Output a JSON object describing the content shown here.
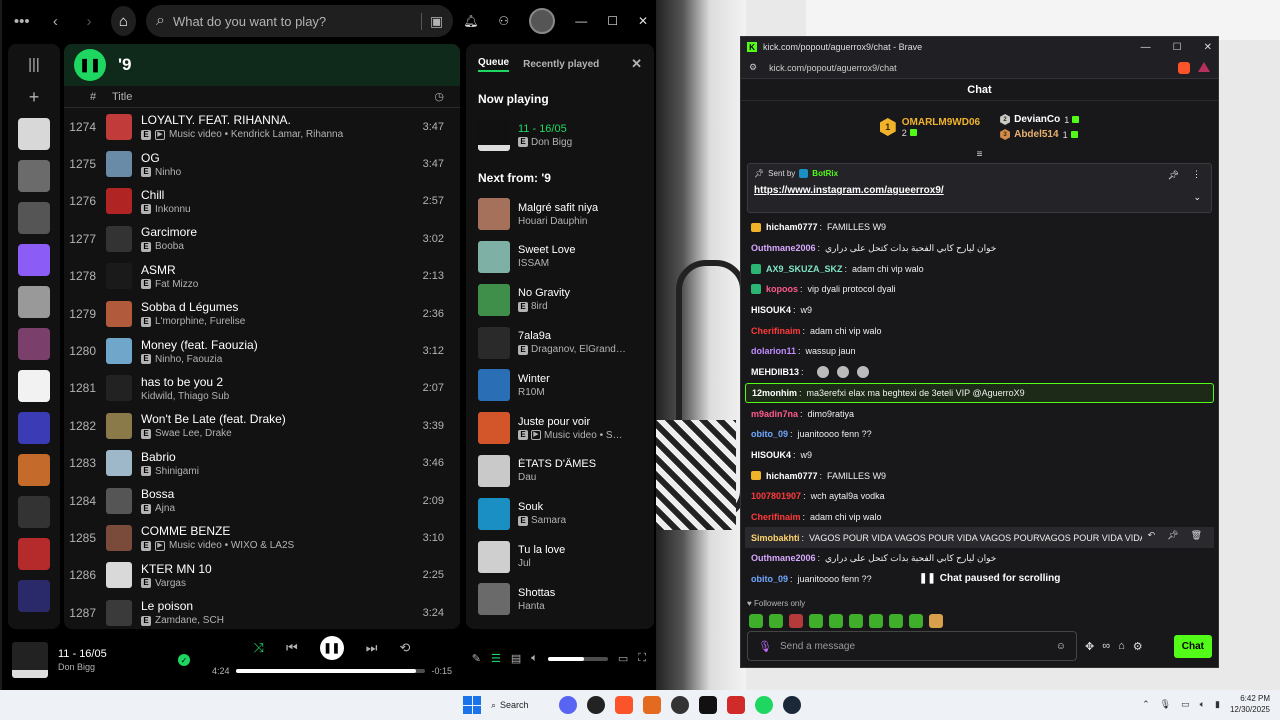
{
  "spotify": {
    "search_placeholder": "What do you want to play?",
    "playlist_title": "'9",
    "columns": {
      "number": "#",
      "title": "Title"
    },
    "tracks": [
      {
        "num": "1274",
        "title": "LOYALTY. FEAT. RIHANNA.",
        "explicit": true,
        "video": true,
        "artists": "Music video • Kendrick Lamar, Rihanna",
        "duration": "3:47",
        "color": "#c23b3b"
      },
      {
        "num": "1275",
        "title": "OG",
        "explicit": true,
        "video": false,
        "artists": "Ninho",
        "duration": "3:47",
        "color": "#6a8ba8"
      },
      {
        "num": "1276",
        "title": "Chill",
        "explicit": true,
        "video": false,
        "artists": "Inkonnu",
        "duration": "2:57",
        "color": "#b02424"
      },
      {
        "num": "1277",
        "title": "Garcimore",
        "explicit": true,
        "video": false,
        "artists": "Booba",
        "duration": "3:02",
        "color": "#333333"
      },
      {
        "num": "1278",
        "title": "ASMR",
        "explicit": true,
        "video": false,
        "artists": "Fat Mizzo",
        "duration": "2:13",
        "color": "#1a1a1a"
      },
      {
        "num": "1279",
        "title": "Sobba d Légumes",
        "explicit": true,
        "video": false,
        "artists": "L'morphine, Furelise",
        "duration": "2:36",
        "color": "#b25a3c"
      },
      {
        "num": "1280",
        "title": "Money (feat. Faouzia)",
        "explicit": true,
        "video": false,
        "artists": "Ninho, Faouzia",
        "duration": "3:12",
        "color": "#6fa6c9"
      },
      {
        "num": "1281",
        "title": "has to be you 2",
        "explicit": false,
        "video": false,
        "artists": "Kidwild, Thiago Sub",
        "duration": "2:07",
        "color": "#222222"
      },
      {
        "num": "1282",
        "title": "Won't Be Late (feat. Drake)",
        "explicit": true,
        "video": false,
        "artists": "Swae Lee, Drake",
        "duration": "3:39",
        "color": "#8a7a4a"
      },
      {
        "num": "1283",
        "title": "Babrio",
        "explicit": true,
        "video": false,
        "artists": "Shinigami",
        "duration": "3:46",
        "color": "#9fb8c9"
      },
      {
        "num": "1284",
        "title": "Bossa",
        "explicit": true,
        "video": false,
        "artists": "Ajna",
        "duration": "2:09",
        "color": "#555555"
      },
      {
        "num": "1285",
        "title": "COMME BENZE",
        "explicit": true,
        "video": true,
        "artists": "Music video • WIXO & LA2S",
        "duration": "3:10",
        "color": "#7a4a3a"
      },
      {
        "num": "1286",
        "title": "KTER MN 10",
        "explicit": true,
        "video": false,
        "artists": "Vargas",
        "duration": "2:25",
        "color": "#d9d9d9"
      },
      {
        "num": "1287",
        "title": "Le poison",
        "explicit": true,
        "video": false,
        "artists": "Zamdane, SCH",
        "duration": "3:24",
        "color": "#3a3a3a"
      }
    ],
    "queue": {
      "tab_queue": "Queue",
      "tab_recent": "Recently played",
      "now_playing_label": "Now playing",
      "next_from_label": "Next from: '9",
      "now_playing": {
        "title": "11 - 16/05",
        "artist": "Don Bigg",
        "explicit": true,
        "color": "#dddddd"
      },
      "items": [
        {
          "title": "Malgré safit niya",
          "artist": "Houari Dauphin",
          "explicit": false,
          "video": false,
          "color": "#a5715a"
        },
        {
          "title": "Sweet Love",
          "artist": "ISSAM",
          "explicit": false,
          "video": false,
          "color": "#7fb0a5"
        },
        {
          "title": "No Gravity",
          "artist": "8ird",
          "explicit": true,
          "video": false,
          "color": "#3f8f4a"
        },
        {
          "title": "7ala9a",
          "artist": "Draganov, ElGrand…",
          "explicit": true,
          "video": false,
          "color": "#2a2a2a"
        },
        {
          "title": "Winter",
          "artist": "R10M",
          "explicit": false,
          "video": false,
          "color": "#2a6fb5"
        },
        {
          "title": "Juste pour voir",
          "artist": "Music video • S…",
          "explicit": true,
          "video": true,
          "color": "#d2562a"
        },
        {
          "title": "ÉTATS D'ÂMES",
          "artist": "Dau",
          "explicit": false,
          "video": false,
          "color": "#c9c9c9"
        },
        {
          "title": "Souk",
          "artist": "Samara",
          "explicit": true,
          "video": false,
          "color": "#1a8fc4"
        },
        {
          "title": "Tu la love",
          "artist": "Jul",
          "explicit": false,
          "video": false,
          "color": "#cfcfcf"
        },
        {
          "title": "Shottas",
          "artist": "Hanta",
          "explicit": false,
          "video": false,
          "color": "#6a6a6a"
        }
      ]
    },
    "player": {
      "title": "11 - 16/05",
      "artist": "Don Bigg",
      "elapsed": "4:24",
      "remaining": "-0:15",
      "progress": 0.95,
      "volume": 0.6
    },
    "library_thumbs": [
      "#d8d8d8",
      "#6b6b6b",
      "#555555",
      "#8b5cf6",
      "#999999",
      "#7a3f6a",
      "#f2f2f2",
      "#3b3bb5",
      "#c46a2a",
      "#333333",
      "#b52a2a",
      "#2a2a6a"
    ]
  },
  "brave": {
    "window_title": "kick.com/popout/aguerrox9/chat - Brave",
    "url": "kick.com/popout/aguerrox9/chat"
  },
  "kick": {
    "header": "Chat",
    "leaderboard": {
      "first": {
        "name": "OMARLM9WD06",
        "count": "2"
      },
      "second": {
        "name": "DevianCo",
        "count": "1"
      },
      "third": {
        "name": "Abdel514",
        "count": "1"
      }
    },
    "pinned": {
      "sent_by_label": "Sent by",
      "sender": "BotRix",
      "link": "https://www.instagram.com/agueerrox9/"
    },
    "messages": [
      {
        "user": "hicham0777",
        "text": "FAMILLES W9",
        "color": "#ffffff",
        "badge": "crown"
      },
      {
        "user": "Outhmane2006",
        "text": "خوان ليارح كابي الفحبة بدات كتحل على دراري",
        "color": "#d8a8ff",
        "badge": ""
      },
      {
        "user": "AX9_SKUZA_SKZ",
        "text": "adam chi vip walo",
        "color": "#7fe7c4",
        "badge": "sword"
      },
      {
        "user": "kopoos",
        "text": "vip dyali protocol dyali",
        "color": "#ff5a8a",
        "badge": "sword"
      },
      {
        "user": "HISOUK4",
        "text": "w9",
        "color": "#ffffff",
        "badge": ""
      },
      {
        "user": "Cherifinaim",
        "text": "adam chi vip walo",
        "color": "#ff3b3b",
        "badge": ""
      },
      {
        "user": "dolarion11",
        "text": "wassup jaun",
        "color": "#c08cff",
        "badge": ""
      },
      {
        "user": "MEHDIIB13",
        "text": "",
        "color": "#ffffff",
        "badge": "",
        "emotes": 3
      },
      {
        "user": "12monhim",
        "text": "ma3erefxi elax ma beghtexi de 3eteli VIP @AguerroX9",
        "color": "#ffffff",
        "badge": "",
        "highlight": true
      },
      {
        "user": "m9adin7na",
        "text": "dimo9ratiya",
        "color": "#ff5a8a",
        "badge": ""
      },
      {
        "user": "obito_09",
        "text": "juanitoooo fenn ??",
        "color": "#6fa8ff",
        "badge": ""
      },
      {
        "user": "HISOUK4",
        "text": "w9",
        "color": "#ffffff",
        "badge": ""
      },
      {
        "user": "hicham0777",
        "text": "FAMILLES W9",
        "color": "#ffffff",
        "badge": "crown"
      },
      {
        "user": "1007801907",
        "text": "wch aytal9a vodka",
        "color": "#ff3b3b",
        "badge": ""
      },
      {
        "user": "Cherifinaim",
        "text": "adam chi vip walo",
        "color": "#ff3b3b",
        "badge": ""
      },
      {
        "user": "Simobakhti",
        "text": "VAGOS POUR VIDA VAGOS POUR VIDA VAGOS POURVAGOS POUR VIDA VIDA",
        "color": "#ffd36b",
        "badge": "",
        "hover": true
      },
      {
        "user": "Outhmane2006",
        "text": "خوان ليارح كابي الفحبة بدات كتحل على دراري",
        "color": "#d8a8ff",
        "badge": ""
      },
      {
        "user": "obito_09",
        "text": "juanitoooo fenn ??",
        "color": "#6fa8ff",
        "badge": ""
      }
    ],
    "paused_label": "Chat paused for scrolling",
    "followers_only": "Followers only",
    "composer_placeholder": "Send a message",
    "chat_button": "Chat"
  },
  "taskbar": {
    "search_label": "Search",
    "time": "6:42 PM",
    "date": "12/30/2025"
  }
}
